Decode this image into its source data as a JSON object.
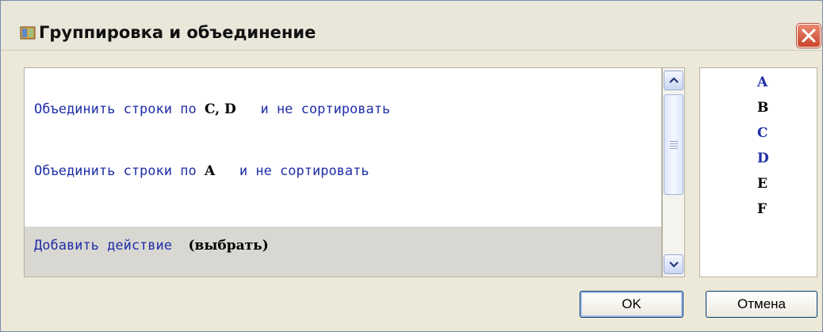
{
  "window": {
    "title": "Группировка и объединение",
    "accent_color": "#1f2fa6"
  },
  "rules": [
    {
      "prefix": "Объединить строки по ",
      "columns": "C, D",
      "suffix": "и не сортировать"
    },
    {
      "prefix": "Объединить строки по ",
      "columns": "A",
      "suffix": "и не сортировать"
    }
  ],
  "add_action": {
    "label": "Добавить действие",
    "choose": "(выбрать)"
  },
  "columns": [
    {
      "name": "A",
      "used": true
    },
    {
      "name": "B",
      "used": false
    },
    {
      "name": "C",
      "used": true
    },
    {
      "name": "D",
      "used": true
    },
    {
      "name": "E",
      "used": false
    },
    {
      "name": "F",
      "used": false
    }
  ],
  "buttons": {
    "ok": "OK",
    "cancel": "Отмена"
  },
  "icons": {
    "app": "app-window-icon",
    "close": "close-icon",
    "scroll_up": "chevron-up-icon",
    "scroll_down": "chevron-down-icon"
  }
}
